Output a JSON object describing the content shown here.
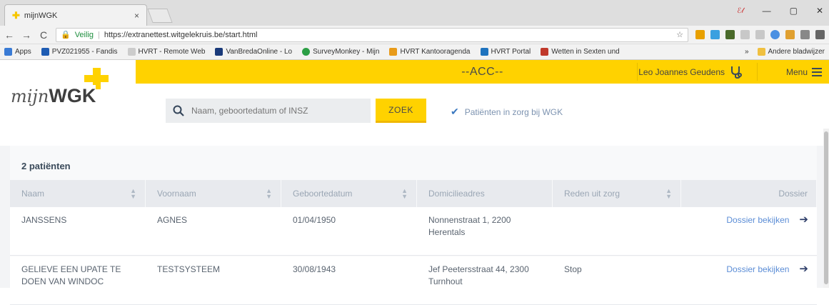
{
  "browser": {
    "tab_title": "mijnWGK",
    "tab_close": "×",
    "user_chip": "ℰ𝓁",
    "nav": {
      "back": "←",
      "forward": "→",
      "reload": "C"
    },
    "secure_label": "Veilig",
    "url": "https://extranettest.witgelekruis.be/start.html",
    "star": "☆",
    "window_controls": {
      "minimize": "—",
      "maximize": "▢",
      "close": "✕"
    },
    "bookmarks": [
      {
        "label": "Apps",
        "color": "#3a7bd5"
      },
      {
        "label": "PVZ021955 - Fandis",
        "color": "#1e5cb3"
      },
      {
        "label": "HVRT - Remote Web",
        "color": "#cccccc"
      },
      {
        "label": "VanBredaOnline - Lo",
        "color": "#1a3a7a"
      },
      {
        "label": "SurveyMonkey - Mijn",
        "color": "#2c9f45"
      },
      {
        "label": "HVRT Kantooragenda",
        "color": "#e89b1a"
      },
      {
        "label": "HVRT Portal",
        "color": "#1e73be"
      },
      {
        "label": "Wetten in Sexten und",
        "color": "#c0392b"
      }
    ],
    "bookmarks_more": "»",
    "other_bookmarks": "Andere bladwijzer"
  },
  "header": {
    "environment": "--ACC--",
    "user_name": "Leo Joannes Geudens",
    "menu_label": "Menu"
  },
  "logo": {
    "mijn": "mijn",
    "wgk": "WGK"
  },
  "search": {
    "placeholder": "Naam, geboortedatum of INSZ",
    "button": "ZOEK",
    "filter_label": "Patiënten in zorg bij WGK"
  },
  "results": {
    "count_label": "2 patiënten",
    "columns": [
      "Naam",
      "Voornaam",
      "Geboortedatum",
      "Domicilieadres",
      "Reden uit zorg",
      "Dossier"
    ],
    "rows": [
      {
        "naam": "JANSSENS",
        "voornaam": "AGNES",
        "geboortedatum": "01/04/1950",
        "adres": "Nonnenstraat 1, 2200 Herentals",
        "reden": "",
        "dossier": "Dossier bekijken"
      },
      {
        "naam": "GELIEVE EEN UPATE TE DOEN VAN WINDOC",
        "voornaam": "TESTSYSTEEM",
        "geboortedatum": "30/08/1943",
        "adres": "Jef Peetersstraat 44, 2300 Turnhout",
        "reden": "Stop",
        "dossier": "Dossier bekijken"
      }
    ]
  }
}
